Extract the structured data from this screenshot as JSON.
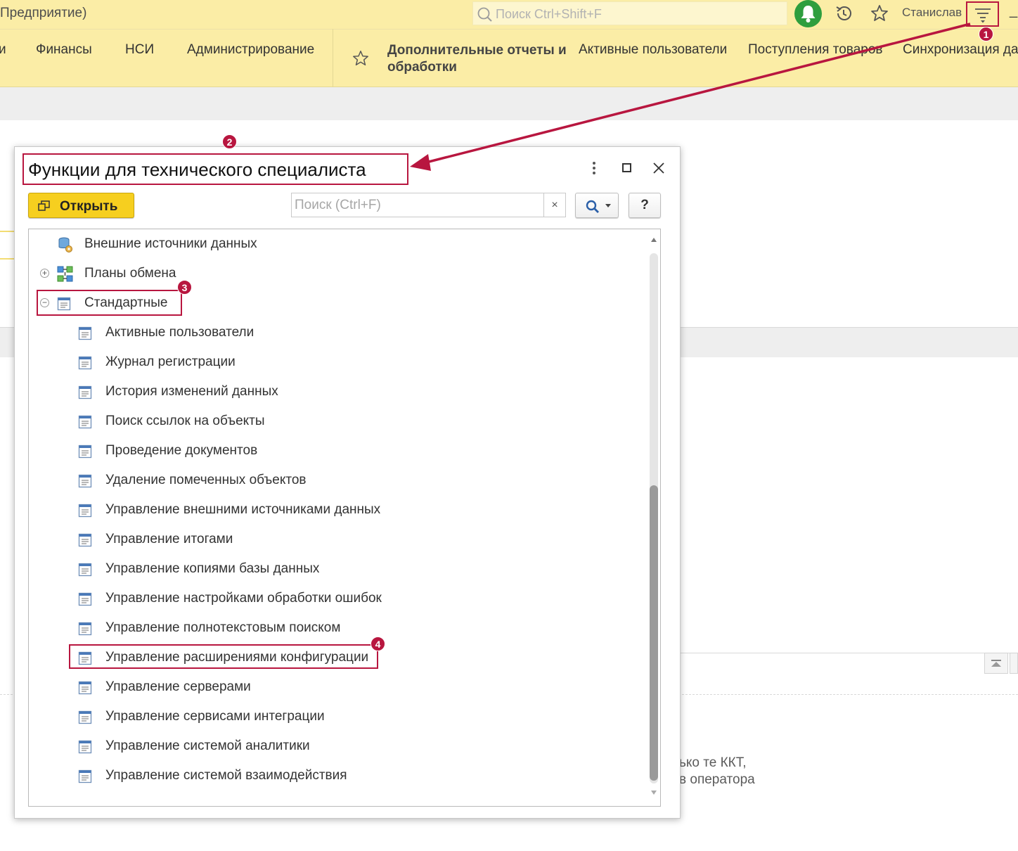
{
  "header": {
    "app_title": "Предприятие)",
    "search_placeholder": "Поиск Ctrl+Shift+F",
    "user_name": "Станислав",
    "minimize_glyph": "_"
  },
  "sections": {
    "items": [
      "и",
      "Финансы",
      "НСИ",
      "Администрирование"
    ],
    "quick_links": [
      "Дополнительные отчеты и обработки",
      "Активные пользователи",
      "Поступления товаров",
      "Синхронизация да"
    ]
  },
  "background_text": [
    "ько те ККТ,",
    "в оператора"
  ],
  "dialog": {
    "title": "Функции для технического специалиста",
    "open_label": "Открыть",
    "search_placeholder": "Поиск (Ctrl+F)",
    "clear_glyph": "×",
    "help_label": "?",
    "tree": [
      {
        "label": "Внешние источники данных",
        "icon": "external-data-icon",
        "level": 0,
        "expander": ""
      },
      {
        "label": "Планы обмена",
        "icon": "exchange-plan-icon",
        "level": 0,
        "expander": "+"
      },
      {
        "label": "Стандартные",
        "icon": "form-icon",
        "level": 0,
        "expander": "−"
      },
      {
        "label": "Активные пользователи",
        "icon": "form-icon",
        "level": 1
      },
      {
        "label": "Журнал регистрации",
        "icon": "form-icon",
        "level": 1
      },
      {
        "label": "История изменений данных",
        "icon": "form-icon",
        "level": 1
      },
      {
        "label": "Поиск ссылок на объекты",
        "icon": "form-icon",
        "level": 1
      },
      {
        "label": "Проведение документов",
        "icon": "form-icon",
        "level": 1
      },
      {
        "label": "Удаление помеченных объектов",
        "icon": "form-icon",
        "level": 1
      },
      {
        "label": "Управление внешними источниками данных",
        "icon": "form-icon",
        "level": 1
      },
      {
        "label": "Управление итогами",
        "icon": "form-icon",
        "level": 1
      },
      {
        "label": "Управление копиями базы данных",
        "icon": "form-icon",
        "level": 1
      },
      {
        "label": "Управление настройками обработки ошибок",
        "icon": "form-icon",
        "level": 1
      },
      {
        "label": "Управление полнотекстовым поиском",
        "icon": "form-icon",
        "level": 1
      },
      {
        "label": "Управление расширениями конфигурации",
        "icon": "form-icon",
        "level": 1
      },
      {
        "label": "Управление серверами",
        "icon": "form-icon",
        "level": 1
      },
      {
        "label": "Управление сервисами интеграции",
        "icon": "form-icon",
        "level": 1
      },
      {
        "label": "Управление системой аналитики",
        "icon": "form-icon",
        "level": 1
      },
      {
        "label": "Управление системой взаимодействия",
        "icon": "form-icon",
        "level": 1
      }
    ]
  },
  "annotations": {
    "badges": [
      "1",
      "2",
      "3",
      "4"
    ],
    "color": "#b8163f"
  },
  "colors": {
    "header_bg": "#fbeda6",
    "primary_button": "#f6cf1f",
    "bell_green": "#2e9e3e"
  }
}
